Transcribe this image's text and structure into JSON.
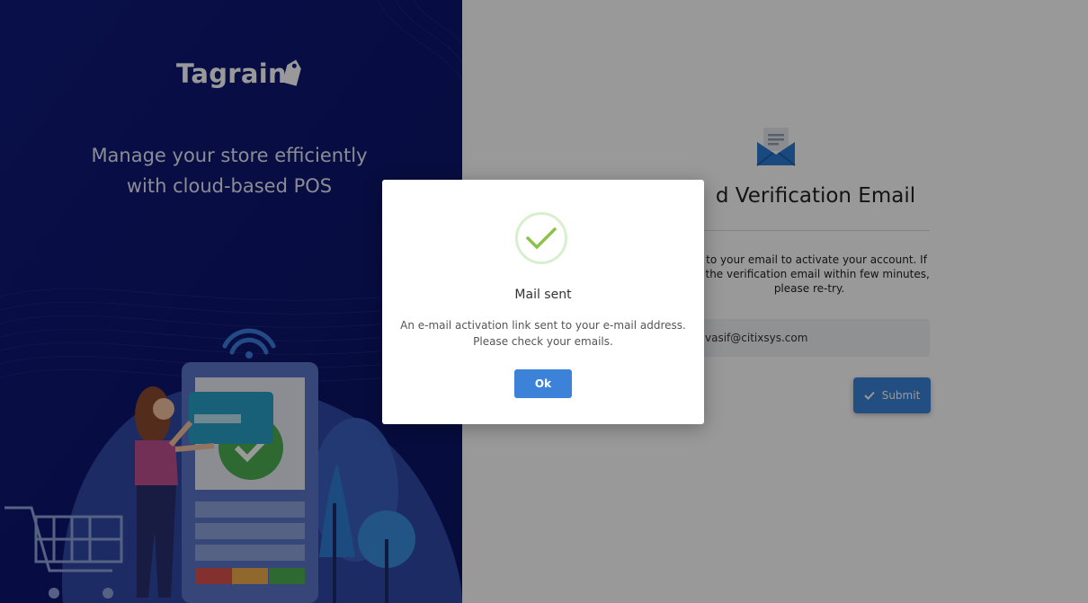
{
  "brand": {
    "logo_text": "Tagrain",
    "tagline_line1": "Manage your store efficiently",
    "tagline_line2": "with cloud-based POS"
  },
  "form": {
    "title": "Resend Verification Email",
    "visible_title": "d Verification Email",
    "desc_line1": "nt to your email to activate your account. If",
    "desc_line2": "ve the verification email within few minutes,",
    "desc_line3": "please re-try.",
    "email_value": "vasif@citixsys.com",
    "submit_label": "Submit"
  },
  "modal": {
    "title": "Mail sent",
    "message_line1": "An e-mail activation link sent to your e-mail address.",
    "message_line2": "Please check your emails.",
    "ok_label": "Ok"
  },
  "colors": {
    "hero_bg": "#0f1a78",
    "accent": "#3b82d8",
    "success": "#8bc34a"
  },
  "icons": {
    "mail": "envelope-open-icon",
    "check": "check-icon",
    "submit": "check-icon"
  }
}
